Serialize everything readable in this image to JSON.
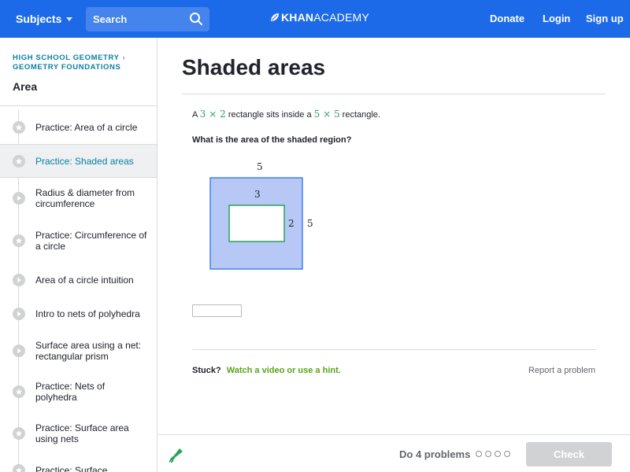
{
  "header": {
    "subjects_label": "Subjects",
    "search_placeholder": "Search",
    "logo_bold": "KHAN",
    "logo_light": "ACADEMY",
    "donate_label": "Donate",
    "login_label": "Login",
    "signup_label": "Sign up"
  },
  "colors": {
    "brand_blue": "#1c6ae8",
    "accent_green": "#29a35a",
    "shaded_fill": "#b7c8f6",
    "outline_blue": "#1c6ae8"
  },
  "sidebar": {
    "breadcrumb_1": "HIGH SCHOOL GEOMETRY",
    "breadcrumb_2": "GEOMETRY FOUNDATIONS",
    "section_title": "Area",
    "items": [
      {
        "label": "Practice: Area of a circle",
        "icon": "star-icon",
        "active": false
      },
      {
        "label": "Practice: Shaded areas",
        "icon": "star-icon",
        "active": true
      },
      {
        "label": "Radius & diameter from circumference",
        "icon": "play-icon",
        "active": false
      },
      {
        "label": "Practice: Circumference of a circle",
        "icon": "star-icon",
        "active": false
      },
      {
        "label": "Area of a circle intuition",
        "icon": "play-icon",
        "active": false
      },
      {
        "label": "Intro to nets of polyhedra",
        "icon": "play-icon",
        "active": false
      },
      {
        "label": "Surface area using a net: rectangular prism",
        "icon": "play-icon",
        "active": false
      },
      {
        "label": "Practice: Nets of polyhedra",
        "icon": "star-icon",
        "active": false
      },
      {
        "label": "Practice: Surface area using nets",
        "icon": "star-icon",
        "active": false
      },
      {
        "label": "Practice: Surface",
        "icon": "star-icon",
        "active": false
      }
    ]
  },
  "exercise": {
    "title": "Shaded areas",
    "prompt_a": "A",
    "inner_dims": "3 × 2",
    "prompt_mid": "rectangle sits inside a",
    "outer_dims": "5 × 5",
    "prompt_end": "rectangle.",
    "question": "What is the area of the shaded region?",
    "figure": {
      "outer_top_label": "5",
      "outer_right_label": "5",
      "inner_top_label": "3",
      "inner_right_label": "2"
    },
    "answer_value": "",
    "stuck_label": "Stuck?",
    "hint_label": "Watch a video or use a hint.",
    "report_label": "Report a problem"
  },
  "footer": {
    "do_problems_label": "Do 4 problems",
    "check_label": "Check",
    "progress_dots": 4
  }
}
